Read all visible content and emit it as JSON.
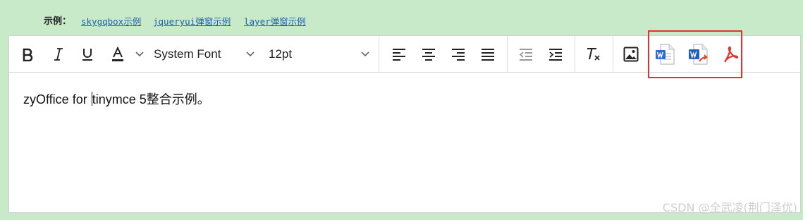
{
  "examples": {
    "label": "示例：",
    "links": [
      "skygqbox示例",
      "jqueryui弹窗示例",
      "layer弹窗示例"
    ]
  },
  "toolbar": {
    "font_family": "System Font",
    "font_size": "12pt",
    "icons": [
      "bold-icon",
      "italic-icon",
      "underline-icon",
      "text-color-icon",
      "align-left-icon",
      "align-center-icon",
      "align-right-icon",
      "align-justify-icon",
      "outdent-icon",
      "indent-icon",
      "clear-formatting-icon",
      "image-icon",
      "word-import-icon",
      "word-export-icon",
      "pdf-icon"
    ],
    "highlight_color": "#e0332b"
  },
  "editor": {
    "content_before_caret": "zyOffice for ",
    "content_after_caret": "tinymce 5整合示例。"
  },
  "watermark": "CSDN @全武凌(荆门泽优)"
}
